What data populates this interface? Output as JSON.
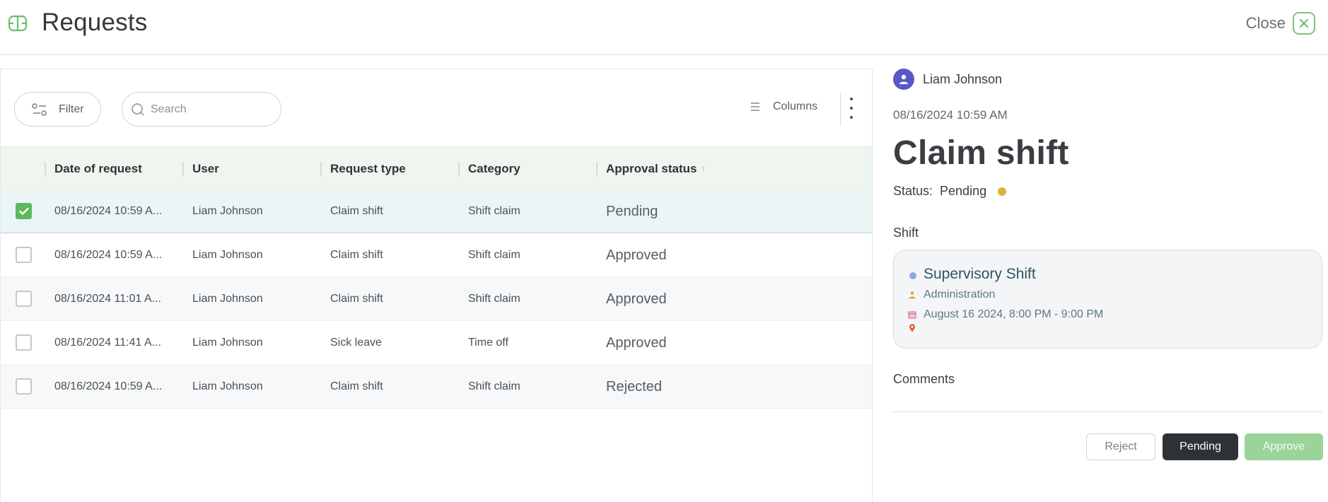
{
  "header": {
    "title": "Requests",
    "close_label": "Close"
  },
  "toolbar": {
    "filter_label": "Filter",
    "search_placeholder": "Search",
    "columns_label": "Columns"
  },
  "table": {
    "columns": [
      "Date of request",
      "User",
      "Request type",
      "Category",
      "Approval status"
    ],
    "rows": [
      {
        "checked": true,
        "date": "08/16/2024 10:59 A...",
        "user": "Liam Johnson",
        "type": "Claim shift",
        "category": "Shift claim",
        "status": "Pending"
      },
      {
        "checked": false,
        "date": "08/16/2024 10:59 A...",
        "user": "Liam Johnson",
        "type": "Claim shift",
        "category": "Shift claim",
        "status": "Approved"
      },
      {
        "checked": false,
        "date": "08/16/2024 11:01 A...",
        "user": "Liam Johnson",
        "type": "Claim shift",
        "category": "Shift claim",
        "status": "Approved"
      },
      {
        "checked": false,
        "date": "08/16/2024 11:41 A...",
        "user": "Liam Johnson",
        "type": "Sick leave",
        "category": "Time off",
        "status": "Approved"
      },
      {
        "checked": false,
        "date": "08/16/2024 10:59 A...",
        "user": "Liam Johnson",
        "type": "Claim shift",
        "category": "Shift claim",
        "status": "Rejected"
      }
    ]
  },
  "detail": {
    "user_name": "Liam Johnson",
    "date": "08/16/2024 10:59 AM",
    "title": "Claim shift",
    "status_label": "Status:",
    "status_value": "Pending",
    "shift_section": "Shift",
    "shift": {
      "name": "Supervisory Shift",
      "department": "Administration",
      "time": "August 16 2024, 8:00 PM - 9:00 PM"
    },
    "comments_section": "Comments",
    "buttons": {
      "reject": "Reject",
      "pending": "Pending",
      "approve": "Approve"
    }
  },
  "colors": {
    "accent_green": "#5cb85c",
    "approve_green": "#9bd49b",
    "pending_dot": "#d9b23f",
    "avatar": "#5a57c8"
  }
}
